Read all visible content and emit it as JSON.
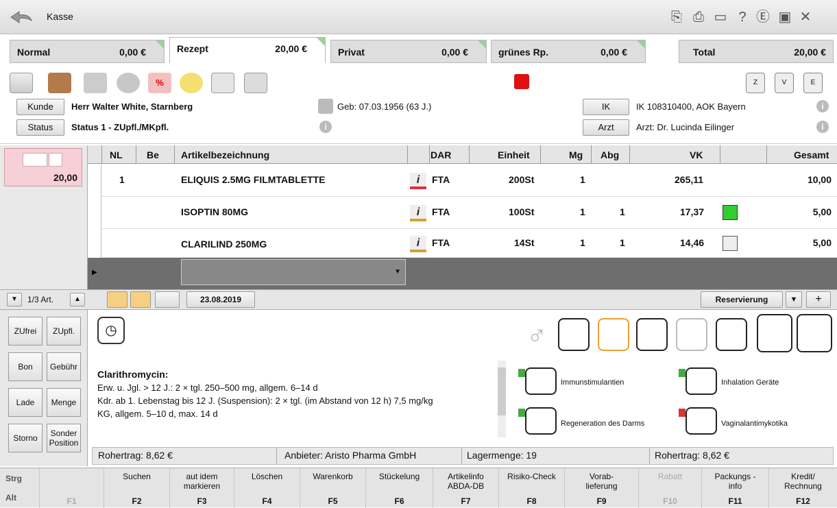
{
  "window": {
    "title": "Kasse"
  },
  "tabs": [
    {
      "label": "Normal",
      "amount": "0,00 €"
    },
    {
      "label": "Rezept",
      "amount": "20,00 €"
    },
    {
      "label": "Privat",
      "amount": "0,00 €"
    },
    {
      "label": "grünes Rp.",
      "amount": "0,00 €"
    },
    {
      "label": "Total",
      "amount": "20,00 €"
    }
  ],
  "customer": {
    "kunde_btn": "Kunde",
    "name": "Herr Walter White, Starnberg",
    "geb": "Geb: 07.03.1956 (63 J.)",
    "status_btn": "Status",
    "status": "Status 1 - ZUpfl./MKpfl.",
    "ik_btn": "IK",
    "ik": "IK 108310400, AOK Bayern",
    "arzt_btn": "Arzt",
    "arzt": "Arzt: Dr. Lucinda Eilinger"
  },
  "receipt": {
    "amount": "20,00",
    "count": "1/3 Art."
  },
  "table": {
    "headers": [
      "NL",
      "Be",
      "Artikelbezeichnung",
      "DAR",
      "Einheit",
      "Mg",
      "Abg",
      "VK",
      "Gesamt"
    ],
    "rows": [
      {
        "nl": "1",
        "name": "ELIQUIS 2.5MG FILMTABLETTE",
        "dar": "FTA",
        "einheit": "200St",
        "mg": "1",
        "abg": "",
        "vk": "265,11",
        "gesamt": "10,00"
      },
      {
        "nl": "",
        "name": "ISOPTIN 80MG",
        "dar": "FTA",
        "einheit": "100St",
        "mg": "1",
        "abg": "1",
        "vk": "17,37",
        "gesamt": "5,00"
      },
      {
        "nl": "",
        "name": "CLARILIND 250MG",
        "dar": "FTA",
        "einheit": "14St",
        "mg": "1",
        "abg": "1",
        "vk": "14,46",
        "gesamt": "5,00"
      }
    ]
  },
  "statusbar": {
    "date": "23.08.2019",
    "reservierung": "Reservierung"
  },
  "leftbuttons": [
    "ZUfrei",
    "ZUpfl.",
    "Bon",
    "Gebühr",
    "Lade",
    "Menge",
    "Storno",
    "Sonder Position"
  ],
  "dosage": {
    "title": "Clarithromycin:",
    "lines": [
      "Erw. u. Jgl. > 12 J.: 2 × tgl. 250–500 mg, allgem. 6–14 d",
      "Kdr. ab 1. Lebenstag  bis 12 J. (Suspension): 2 × tgl. (im Abstand von 12 h) 7,5 mg/kg",
      "KG, allgem. 5–10 d, max. 14 d"
    ]
  },
  "categories": [
    "Immunstimulantien",
    "Inhalation Geräte",
    "Regeneration des Darms",
    "Vaginalantimykotika"
  ],
  "footer": {
    "rohertrag1": "Rohertrag: 8,62 €",
    "anbieter": "Anbieter: Aristo Pharma GmbH",
    "lager": "Lagermenge: 19",
    "rohertrag2": "Rohertrag: 8,62 €"
  },
  "fkeys": {
    "strg": "Strg",
    "alt": "Alt",
    "keys": [
      {
        "label": "",
        "key": "F1"
      },
      {
        "label": "Suchen",
        "key": "F2"
      },
      {
        "label": "aut idem markieren",
        "key": "F3"
      },
      {
        "label": "Löschen",
        "key": "F4"
      },
      {
        "label": "Warenkorb",
        "key": "F5"
      },
      {
        "label": "Stückelung",
        "key": "F6"
      },
      {
        "label": "Artikelinfo ABDA-DB",
        "key": "F7"
      },
      {
        "label": "Risiko-Check",
        "key": "F8"
      },
      {
        "label": "Vorab-lieferung",
        "key": "F9"
      },
      {
        "label": "Rabatt",
        "key": "F10"
      },
      {
        "label": "Packungs - info",
        "key": "F11"
      },
      {
        "label": "Kredit/ Rechnung",
        "key": "F12"
      }
    ]
  },
  "colors": {
    "accent_orange": "#f0a030",
    "stop_red": "#e01010",
    "receipt_pink": "#f7cfd6"
  }
}
